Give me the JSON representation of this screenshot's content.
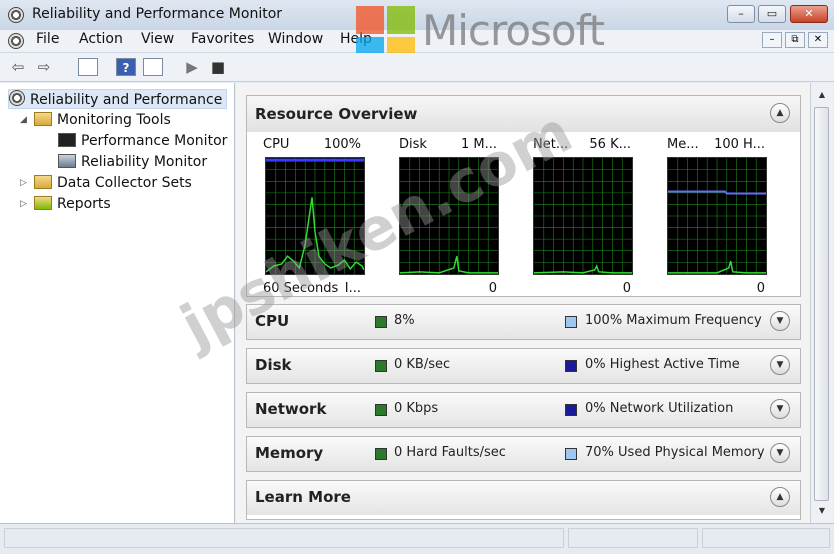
{
  "window": {
    "title": "Reliability and Performance Monitor",
    "minimize": "–",
    "restore": "▭",
    "close": "✕"
  },
  "menu": {
    "items": [
      "File",
      "Action",
      "View",
      "Favorites",
      "Window",
      "Help"
    ],
    "mdi": [
      "–",
      "⧉",
      "✕"
    ]
  },
  "watermark": {
    "brand": "Microsoft",
    "site": "jpshiken.com"
  },
  "tree": {
    "root": "Reliability and Performance",
    "monitoring_tools": "Monitoring Tools",
    "performance_monitor": "Performance Monitor",
    "reliability_monitor": "Reliability Monitor",
    "data_collector_sets": "Data Collector Sets",
    "reports": "Reports"
  },
  "overview": {
    "title": "Resource Overview",
    "graphs": [
      {
        "label": "CPU",
        "value": "100%",
        "bottom_left": "60 Seconds",
        "bottom_right": "I..."
      },
      {
        "label": "Disk",
        "value": "1 M...",
        "bottom_left": "",
        "bottom_right": "0"
      },
      {
        "label": "Net...",
        "value": "56 K...",
        "bottom_left": "",
        "bottom_right": "0"
      },
      {
        "label": "Me...",
        "value": "100 H...",
        "bottom_left": "",
        "bottom_right": "0"
      }
    ]
  },
  "summaries": [
    {
      "title": "CPU",
      "left": "8%",
      "right": "100% Maximum Frequency"
    },
    {
      "title": "Disk",
      "left": "0 KB/sec",
      "right": "0% Highest Active Time"
    },
    {
      "title": "Network",
      "left": "0 Kbps",
      "right": "0% Network Utilization"
    },
    {
      "title": "Memory",
      "left": "0 Hard Faults/sec",
      "right": "70% Used Physical Memory"
    }
  ],
  "learn_more": {
    "title": "Learn More"
  },
  "colors": {
    "green_swatch": "#2a7a2a",
    "blue_swatch": "#1a1a9a",
    "light_blue_swatch": "#9fc8f0",
    "graph_grid": "#1c8a1c",
    "graph_line": "#33dd33",
    "graph_blue": "#3a3aff"
  }
}
